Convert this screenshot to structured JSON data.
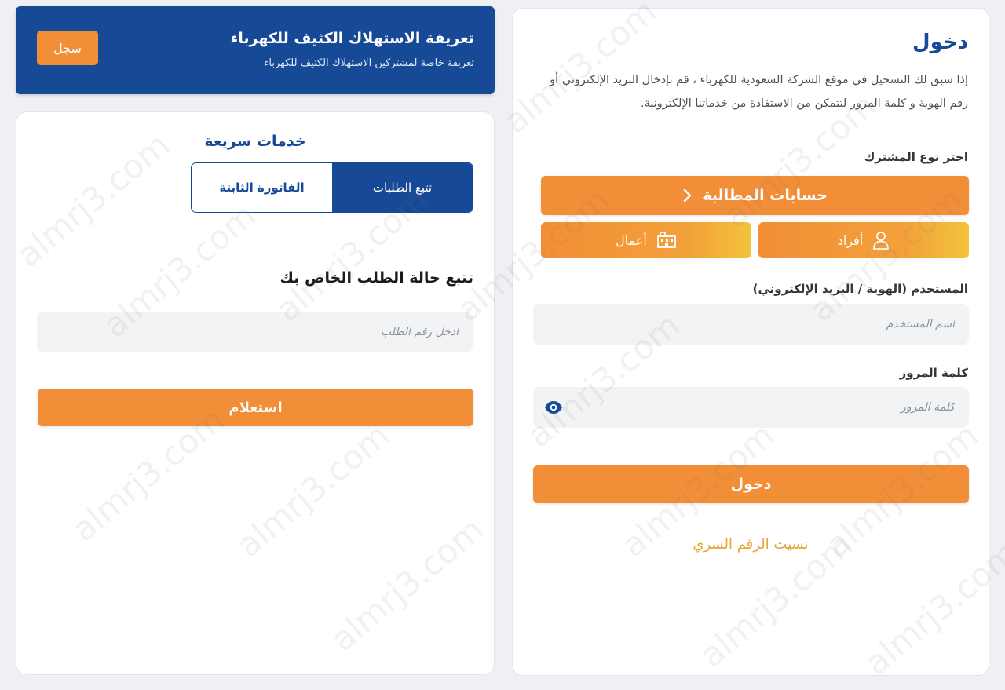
{
  "watermark": "almrj3.com",
  "banner": {
    "title": "تعريفة الاستهلاك الكثيف للكهرباء",
    "subtitle": "تعريفة خاصة لمشتركين الاستهلاك الكثيف للكهرباء",
    "register_label": "سجل"
  },
  "quick_services": {
    "title": "خدمات سريعة",
    "tabs": [
      {
        "label": "تتبع الطلبات",
        "active": true
      },
      {
        "label": "الفاتورة الثابتة",
        "active": false
      }
    ],
    "track_title": "تتبع حالة الطلب الخاص بك",
    "request_placeholder": "ادخل رقم الطلب",
    "inquiry_label": "استعلام"
  },
  "login": {
    "title": "دخول",
    "intro": "إذا سبق لك التسجيل في موقع الشركة السعودية للكهرباء ، قم بإدخال البريد الإلكتروني أو رقم الهوية و كلمة المرور لتتمكن من الاستفادة من خدماتنا الإلكترونية.",
    "subscriber_type_label": "اختر نوع المشترك",
    "accounts_label": "حسابات المطالبة",
    "types": [
      {
        "label": "أفراد",
        "icon": "person-icon"
      },
      {
        "label": "أعمال",
        "icon": "building-icon"
      }
    ],
    "username_label": "المستخدم (الهوية / البريد الإلكتروني)",
    "username_placeholder": "اسم المستخدم",
    "password_label": "كلمة المرور",
    "password_placeholder": "كلمة المرور",
    "login_label": "دخول",
    "forgot_label": "نسيت الرقم السري"
  },
  "colors": {
    "primary_blue": "#174a96",
    "accent_orange": "#f28e37",
    "link_gold": "#e8a22e"
  }
}
